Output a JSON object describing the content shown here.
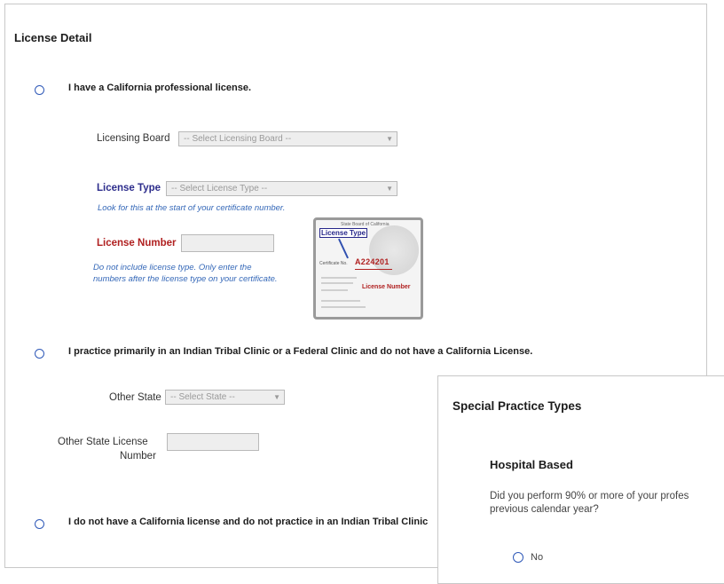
{
  "license_detail": {
    "title": "License Detail",
    "option_ca_license": "I have a California professional license.",
    "licensing_board": {
      "label": "Licensing Board",
      "value": "-- Select Licensing Board --"
    },
    "license_type": {
      "label": "License Type",
      "value": "-- Select License Type --",
      "hint": "Look for this at the start of your certificate number."
    },
    "license_number": {
      "label": "License Number",
      "value": "",
      "hint_line1": "Do not include license type.  Only enter the",
      "hint_line2": "numbers after the license type on your certificate."
    },
    "certificate_example": {
      "type_label": "License Type",
      "number": "A224201",
      "number_label": "License Number"
    },
    "option_tribal": "I practice primarily in an Indian Tribal Clinic or a Federal Clinic and do not have a California License.",
    "other_state": {
      "label": "Other State",
      "value": "-- Select State --"
    },
    "other_state_license": {
      "label_line1": "Other State License",
      "label_line2": "Number",
      "value": ""
    },
    "option_none": "I do not have a California license and do not practice in an Indian Tribal Clinic"
  },
  "special_practice": {
    "title": "Special Practice Types",
    "subtitle": "Hospital Based",
    "question_line1": "Did you perform 90% or more of your profes",
    "question_line2": "previous calendar year?",
    "option_no": "No"
  },
  "colors": {
    "accent_blue": "#2f59b8",
    "label_blue": "#2d2d8c",
    "label_red": "#b02020",
    "hint_blue": "#3568b8"
  }
}
